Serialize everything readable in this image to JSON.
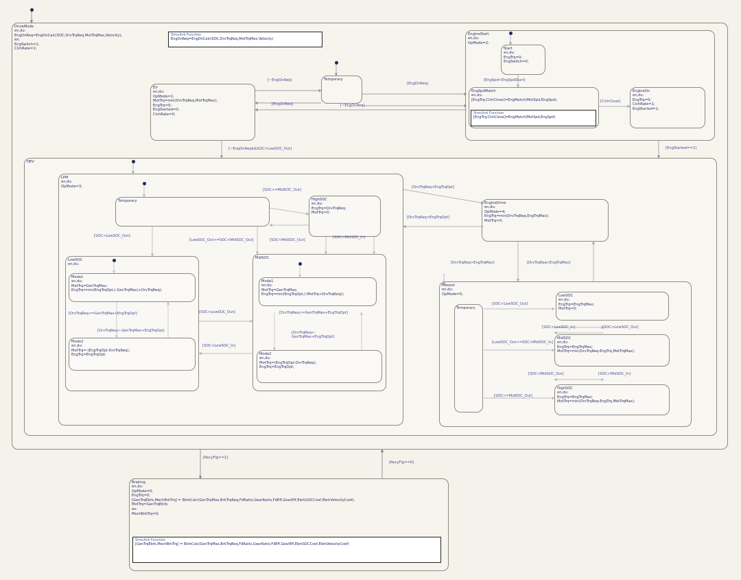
{
  "states": {
    "drive": {
      "name": "DriveMode",
      "body": "en,du:\nEngOnReq=EngOnCalc(SOC,DrvTrqReq,MotTrqMax,Velocity);\nex:\nEngSwitch=1;\nClchRate=1;"
    },
    "ev": {
      "name": "EV",
      "body": "en,du:\nOpMode=1;\nMotTrq=min(DrvTrqReq,MotTrqMax);\nEngTrq=0;\nEngStarted=0;\nClchRate=0;"
    },
    "temp_top": {
      "name": "Temporary",
      "body": ""
    },
    "engine_start": {
      "name": "EngineStart",
      "body": "en,du:\nOpMode=2;"
    },
    "start": {
      "name": "Start",
      "body": "en,du:\nEngTrq=0;\nEngSwitch=0;"
    },
    "eng_spd_match": {
      "name": "EngSpdMatch",
      "body": "en,du:\n[EngTrq,ClchClose]=EngMatch(MotSpd,EngSpd);"
    },
    "engine_on": {
      "name": "EngineOn",
      "body": "en,du:\nEngTrq=0;\nClchRate=1;\nEngStarted=1;"
    },
    "hev": {
      "name": "HEV",
      "body": ""
    },
    "lpm": {
      "name": "LPM",
      "body": "en,du:\nOpMode=3;"
    },
    "temp_lpm": {
      "name": "Temporary",
      "body": ""
    },
    "high_soc": {
      "name": "HighSOC",
      "body": "en,du:\nEngTrq=DrvTrqReq;\nMotTrq=0;"
    },
    "low_soc": {
      "name": "LowSOC",
      "body": "en,du:"
    },
    "mode1_low": {
      "name": "Mode1",
      "body": "en,du:\nMotTrq=GenTrqMax;\nEngTrq=min(EngTrqOpt,(-GenTrqMax)+DrvTrqReq);"
    },
    "mode2_low": {
      "name": "Mode2",
      "body": "en,du:\nMotTrq=-(EngTrqOpt-DrvTrqReq);\nEngTrq=EngTrqOpt;"
    },
    "mid_soc": {
      "name": "MidSOC",
      "body": ""
    },
    "mode1_mid": {
      "name": "Mode1",
      "body": "en,du:\nMotTrq=GenTrqMax;\nEngTrq=min(EngTrqOpt,(-MotTrq+DrvTrqReq));"
    },
    "mode2_mid": {
      "name": "Mode2",
      "body": "en,du:\nMotTrq=(EngTrqOpt-DrvTrqReq);\nEngTrq=EngTrqOpt;"
    },
    "engine_drive": {
      "name": "EngineDrive",
      "body": "en,du:\nOpMode=4;\nEngTrq=min(DrvTrqReq,EngTrqMax);\nMotTrq=0;"
    },
    "mboost": {
      "name": "Mboost",
      "body": "en,du:\nOpMode=5;"
    },
    "temp_mb": {
      "name": "Temporary",
      "body": ""
    },
    "mb_low": {
      "name": "LowSOC",
      "body": "en,du:\nEngTrq=EngTrqMax;\nMotTrq=0;"
    },
    "mb_mid": {
      "name": "MidSOC",
      "body": "en,du:\nEngTrq=EngTrqMax;\nMotTrq=min(DrvTrqReq-EngTrq,MotTrqMax);"
    },
    "mb_high": {
      "name": "HighSOC",
      "body": "en,du:\nEngTrq=EngTrqMax;\nMotTrq=min(DrvTrqReq-EngTrq,MotTrqMax);"
    },
    "braking": {
      "name": "Braking",
      "body": "en,du:\nOpMode=0;\nEngTrq=0;\n[GenTrqEbrk,MechBrkTrq] = EbrkCalc(GenTrqMax,BrkTrqReq,FdRatio,GearRatio,FdEff,GearEff,EbrkSOCCoef,EbrkVelocityCoef);\nMotTrq=GenTrqEbrk;\nex:\nMechBrkTrq=0;"
    }
  },
  "functions": {
    "drive_fn": {
      "header": "Simulink Function",
      "body": "EngOnReq=EngOnCalc(SOC,DrvTrqReq,MotTrqMax,Velocity)"
    },
    "match_fn": {
      "header": "Simulink Function",
      "body": "[EngTrq,ClchClose]=EngMatch(MotSpd,EngSpd)"
    },
    "brake_fn": {
      "header": "Simulink Function",
      "body": "[GenTrqEbrk,MechBrkTrq] = EbrkCalc(GenTrqMax,BrkTrqReq,FdRatio,GearRatio,FdEff,GearEff,EbrkSOCCoef,EbrkVelocityCoef)"
    }
  },
  "transitions": {
    "t1": "[~EngOnReq]",
    "t2": "[EngOnReq]",
    "t3": "[~EngOnReq]",
    "t4": "[EngOnReq]",
    "t5": "[EngSpd>EngSpdStart]",
    "t6": "[ClchClose]",
    "t7": "[~EngOnReq&&SOC>LowSOC_Out]",
    "t8": "[EngStarted==1]",
    "t9": "[SOC>=MidSOC_Out]",
    "t10": "[SOC<LowSOC_Out]",
    "t11": "[LowSOC_Out<=SOC<MidSOC_Out]",
    "t12": "[SOC<MidSOC_Out]",
    "t13": "[SOC>MidSOC_In]",
    "t14": "[SOC>LowSOC_Out]",
    "t15": "[SOC<LowSOC_In]",
    "t16": "[DrvTrqReq<=GenTrqMax+EngTrqOpt]",
    "t17": "[DrvTrqReq>-GenTrqMax+EngTrqOpt]",
    "t18": "[DrvTrqReq<=GenTrqMax+EngTrqOpt]",
    "t19": "[DrvTrqReq>-GenTrqMax+EngTrqOpt]",
    "t20": "[DrvTrqReq>EngTrqOpt]",
    "t21": "[DrvTrqReq<EngTrqOpt]",
    "t22": "[DrvTrqReq>EngTrqMax]",
    "t23": "[DrvTrqReq<EngTrqMax]",
    "t24": "[SOC<LowSOC_Out]",
    "t25": "[SOC<LowSOC_In]",
    "t26": "[SOC>LowSOC_Out]",
    "t27": "[LowSOC_Out<=SOC<MidSOC_In]",
    "t28": "[SOC<MidSOC_Out]",
    "t29": "[SOC>MidSOC_In]",
    "t30": "[SOC>=MidSOC_Out]",
    "t31": "[RecyFlg==1]",
    "t32": "[RecyFlg==0]"
  },
  "colors": {
    "border": "#8e8a80",
    "text": "#2e2e6a",
    "transition": "#4a4a9a",
    "background": "#f4f2ea"
  }
}
